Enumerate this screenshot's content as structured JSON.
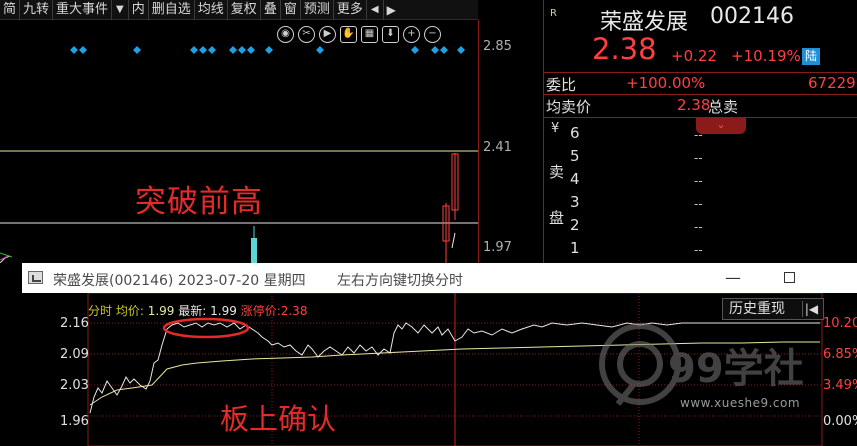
{
  "toolbar": {
    "items": [
      "简",
      "九转",
      "重大事件",
      "▼",
      "内",
      "删自选",
      "均线",
      "复权",
      "叠",
      "窗",
      "预测",
      "更多"
    ],
    "arrows": [
      "◀",
      "▶"
    ]
  },
  "kline": {
    "price_labels": [
      "2.85",
      "2.41",
      "1.97"
    ],
    "annotation": "突破前高"
  },
  "quote": {
    "corner_mark": "R",
    "name": "荣盛发展",
    "code": "002146",
    "price": "2.38",
    "change": "+0.22",
    "change_pct": "+10.19%",
    "market_badge": "陆",
    "weibi_label": "委比",
    "weibi_value": "+100.00%",
    "weibi_extra": "67229",
    "avg_label": "均卖价",
    "avg_value": "2.38",
    "avg_sell": "总卖",
    "orderbook": {
      "yen": "¥",
      "side_chars": [
        "卖",
        "盘"
      ],
      "levels": [
        "6",
        "5",
        "4",
        "3",
        "2",
        "1"
      ],
      "values": [
        "--",
        "--",
        "--",
        "--",
        "--",
        "--"
      ]
    }
  },
  "popup": {
    "title": "荣盛发展(002146) 2023-07-20 星期四",
    "hint": "左右方向键切换分时",
    "info": {
      "fenshi": "分时",
      "avg_k": "均价:",
      "avg_v": "1.99",
      "last_k": "最新:",
      "last_v": "1.99",
      "limit_k": "涨停价:",
      "limit_v": "2.38"
    },
    "history_button": "历史重现",
    "back_icon": "|◀",
    "y_left": [
      "2.16",
      "2.09",
      "2.03",
      "1.96"
    ],
    "y_right": [
      "10.20",
      "6.85%",
      "3.49%",
      "0.00%"
    ],
    "annotation": "板上确认"
  },
  "watermark": {
    "logo_text": "99学社",
    "url": "www.xueshe9.com"
  },
  "colors": {
    "up_red": "#ff4040",
    "annot_red": "#e52a2a",
    "grid_red": "#8b1a1a",
    "avg_yellow": "#e8e8a0",
    "diamond_blue": "#1fa0e0"
  }
}
